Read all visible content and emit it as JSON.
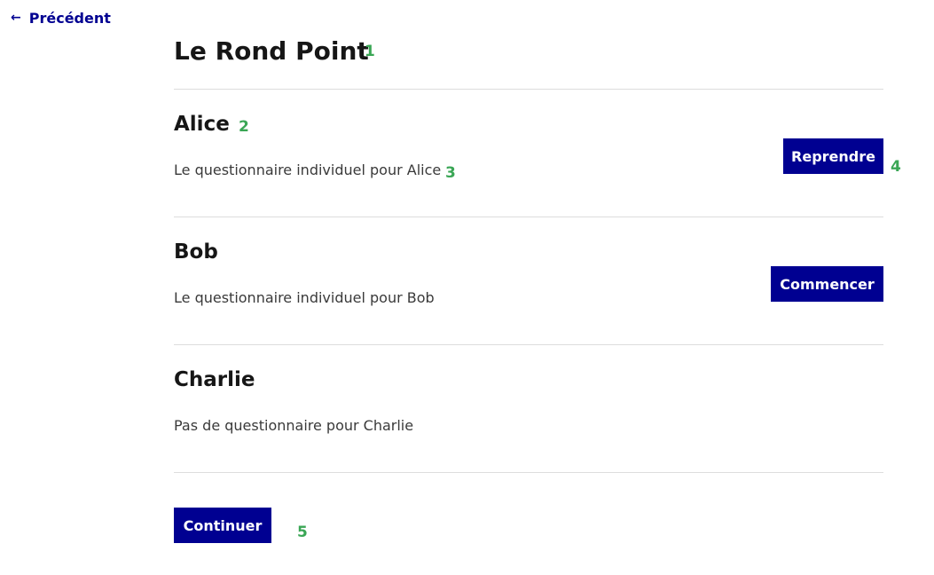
{
  "nav": {
    "back_label": "Précédent"
  },
  "page": {
    "title": "Le Rond Point"
  },
  "persons": [
    {
      "name": "Alice",
      "description": "Le questionnaire individuel pour Alice",
      "action_label": "Reprendre"
    },
    {
      "name": "Bob",
      "description": "Le questionnaire individuel pour Bob",
      "action_label": "Commencer"
    },
    {
      "name": "Charlie",
      "description": "Pas de questionnaire pour Charlie"
    }
  ],
  "footer": {
    "continue_label": "Continuer"
  },
  "markers": [
    "1",
    "2",
    "3",
    "4",
    "5"
  ],
  "colors": {
    "primary": "#000091",
    "marker": "#3aa655",
    "text": "#161616",
    "divider": "#dddddd"
  }
}
